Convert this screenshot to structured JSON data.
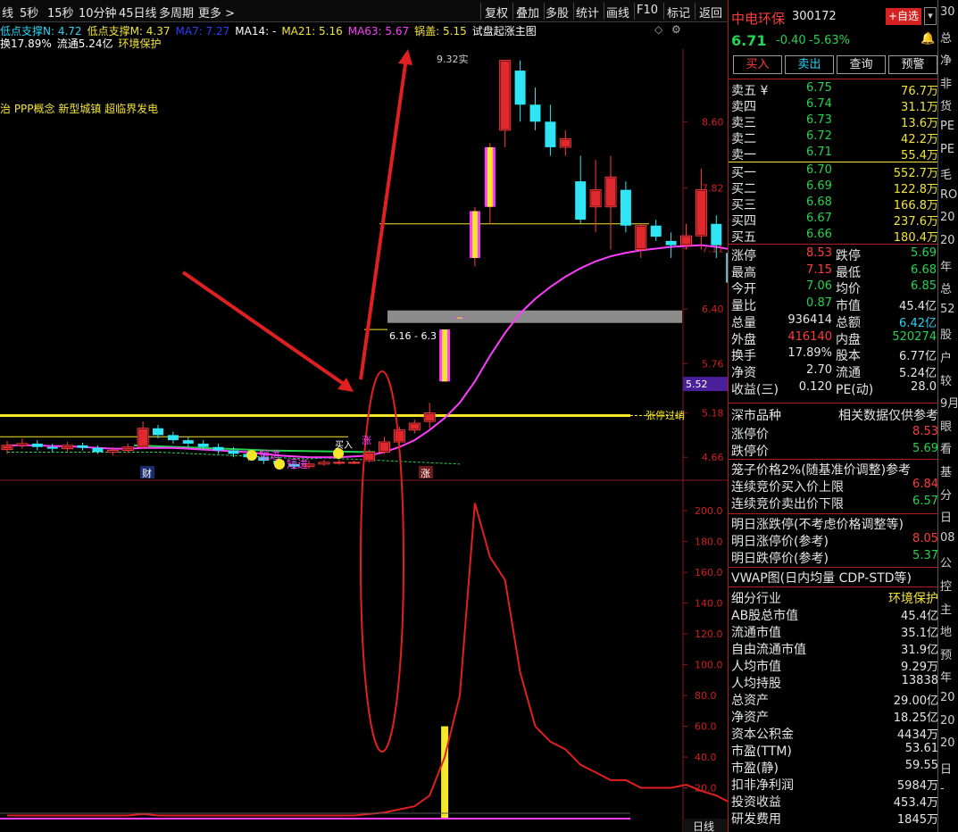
{
  "toolbar": {
    "left_items": [
      "线",
      "5秒",
      "15秒",
      "10分钟",
      "45日线",
      "多周期",
      "更多 >"
    ],
    "right_buttons": [
      "复权",
      "叠加",
      "多股",
      "统计",
      "画线",
      "F10",
      "标记",
      "返回"
    ]
  },
  "legend": {
    "line1": [
      {
        "text": "低点支撑N: 4.72",
        "color": "#2ad3f5"
      },
      {
        "text": "低点支撑M: 4.37",
        "color": "#f2e33a"
      },
      {
        "text": "MA7: 7.27",
        "color": "#2a3ef5"
      },
      {
        "text": "MA14: -",
        "color": "#ffffff"
      },
      {
        "text": "MA21: 5.16",
        "color": "#f2e33a"
      },
      {
        "text": "MA63: 5.67",
        "color": "#ff3cff"
      },
      {
        "text": "锅盖: 5.15",
        "color": "#f2e33a"
      },
      {
        "text": "试盘起涨主图",
        "color": "#ffffff"
      }
    ],
    "line2": [
      {
        "text": "换17.89%",
        "color": "#ffffff"
      },
      {
        "text": "流通5.24亿",
        "color": "#ffffff"
      },
      {
        "text": "环境保护",
        "color": "#f2e33a"
      }
    ],
    "concepts": "治 PPP概念 新型城镇 超临界发电"
  },
  "price_axis": [
    "8.60",
    "7.82",
    "7.11",
    "6.40",
    "5.76",
    "5.18",
    "4.66"
  ],
  "price_tag": "5.52",
  "volume_axis": [
    "200.0",
    "180.0",
    "160.0",
    "140.0",
    "120.0",
    "100.0",
    "80.0",
    "60.0",
    "40.0",
    "20.0"
  ],
  "annotations": {
    "high_label": "9.32实",
    "range_label": "6.16 - 6.3",
    "limit_label": "张停过峭",
    "cai": "财",
    "zhang": "涨",
    "duan1": "短进",
    "duan2": "短进",
    "buy": "买入",
    "zhang2": "涨"
  },
  "bottom_tab": "日线",
  "chart_data": {
    "type": "candlestick",
    "candles": [
      {
        "o": 4.75,
        "c": 4.8,
        "h": 4.85,
        "l": 4.7
      },
      {
        "o": 4.8,
        "c": 4.82,
        "h": 4.88,
        "l": 4.76
      },
      {
        "o": 4.82,
        "c": 4.78,
        "h": 4.86,
        "l": 4.74
      },
      {
        "o": 4.78,
        "c": 4.76,
        "h": 4.82,
        "l": 4.72
      },
      {
        "o": 4.76,
        "c": 4.8,
        "h": 4.84,
        "l": 4.73
      },
      {
        "o": 4.8,
        "c": 4.77,
        "h": 4.83,
        "l": 4.74
      },
      {
        "o": 4.77,
        "c": 4.72,
        "h": 4.8,
        "l": 4.7
      },
      {
        "o": 4.72,
        "c": 4.74,
        "h": 4.78,
        "l": 4.68
      },
      {
        "o": 4.74,
        "c": 4.78,
        "h": 4.82,
        "l": 4.71
      },
      {
        "o": 4.78,
        "c": 5.0,
        "h": 5.08,
        "l": 4.76
      },
      {
        "o": 5.0,
        "c": 4.92,
        "h": 5.04,
        "l": 4.88
      },
      {
        "o": 4.92,
        "c": 4.86,
        "h": 4.96,
        "l": 4.82
      },
      {
        "o": 4.86,
        "c": 4.82,
        "h": 4.9,
        "l": 4.78
      },
      {
        "o": 4.82,
        "c": 4.78,
        "h": 4.86,
        "l": 4.74
      },
      {
        "o": 4.78,
        "c": 4.74,
        "h": 4.82,
        "l": 4.7
      },
      {
        "o": 4.74,
        "c": 4.7,
        "h": 4.78,
        "l": 4.66
      },
      {
        "o": 4.7,
        "c": 4.66,
        "h": 4.74,
        "l": 4.62
      },
      {
        "o": 4.66,
        "c": 4.62,
        "h": 4.7,
        "l": 4.58
      },
      {
        "o": 4.62,
        "c": 4.58,
        "h": 4.66,
        "l": 4.54
      },
      {
        "o": 4.58,
        "c": 4.55,
        "h": 4.62,
        "l": 4.52
      },
      {
        "o": 4.55,
        "c": 4.58,
        "h": 4.62,
        "l": 4.52
      },
      {
        "o": 4.58,
        "c": 4.6,
        "h": 4.63,
        "l": 4.56
      },
      {
        "o": 4.6,
        "c": 4.6,
        "h": 4.63,
        "l": 4.57
      },
      {
        "o": 4.6,
        "c": 4.6,
        "h": 4.62,
        "l": 4.58
      },
      {
        "o": 4.62,
        "c": 4.72,
        "h": 4.75,
        "l": 4.6
      },
      {
        "o": 4.72,
        "c": 4.84,
        "h": 4.9,
        "l": 4.7
      },
      {
        "o": 4.84,
        "c": 4.98,
        "h": 5.02,
        "l": 4.8
      },
      {
        "o": 4.98,
        "c": 5.06,
        "h": 5.1,
        "l": 4.94
      },
      {
        "o": 5.08,
        "c": 5.18,
        "h": 5.3,
        "l": 5.0
      },
      {
        "o": 5.55,
        "c": 6.16,
        "h": 6.16,
        "l": 5.55
      },
      {
        "o": 6.3,
        "c": 6.3,
        "h": 6.3,
        "l": 6.3
      },
      {
        "o": 7.0,
        "c": 7.55,
        "h": 7.6,
        "l": 6.9
      },
      {
        "o": 7.6,
        "c": 8.3,
        "h": 8.35,
        "l": 7.4
      },
      {
        "o": 8.5,
        "c": 9.32,
        "h": 9.32,
        "l": 8.3
      },
      {
        "o": 9.2,
        "c": 8.8,
        "h": 9.32,
        "l": 8.6
      },
      {
        "o": 8.8,
        "c": 8.6,
        "h": 9.0,
        "l": 8.5
      },
      {
        "o": 8.6,
        "c": 8.3,
        "h": 8.8,
        "l": 8.2
      },
      {
        "o": 8.3,
        "c": 8.4,
        "h": 8.5,
        "l": 8.2
      },
      {
        "o": 7.9,
        "c": 7.45,
        "h": 8.2,
        "l": 7.4
      },
      {
        "o": 7.6,
        "c": 7.8,
        "h": 8.15,
        "l": 7.3
      },
      {
        "o": 7.6,
        "c": 7.95,
        "h": 8.2,
        "l": 7.1
      },
      {
        "o": 7.8,
        "c": 7.38,
        "h": 7.9,
        "l": 7.3
      },
      {
        "o": 7.1,
        "c": 7.38,
        "h": 7.4,
        "l": 7.0
      },
      {
        "o": 7.38,
        "c": 7.25,
        "h": 7.45,
        "l": 7.2
      },
      {
        "o": 7.2,
        "c": 7.15,
        "h": 7.3,
        "l": 7.0
      },
      {
        "o": 7.15,
        "c": 7.26,
        "h": 7.4,
        "l": 7.1
      },
      {
        "o": 7.26,
        "c": 7.8,
        "h": 8.05,
        "l": 7.1
      },
      {
        "o": 7.4,
        "c": 7.15,
        "h": 7.5,
        "l": 7.0
      },
      {
        "o": 7.06,
        "c": 6.71,
        "h": 7.15,
        "l": 6.68
      }
    ],
    "ma_pink": [
      4.8,
      4.8,
      4.8,
      4.79,
      4.79,
      4.78,
      4.77,
      4.76,
      4.76,
      4.77,
      4.77,
      4.77,
      4.76,
      4.75,
      4.74,
      4.73,
      4.72,
      4.7,
      4.68,
      4.67,
      4.66,
      4.66,
      4.66,
      4.67,
      4.68,
      4.72,
      4.78,
      4.86,
      4.98,
      5.12,
      5.3,
      5.55,
      5.85,
      6.12,
      6.35,
      6.52,
      6.66,
      6.78,
      6.88,
      6.96,
      7.02,
      7.06,
      7.09,
      7.11,
      7.13,
      7.14,
      7.15,
      7.13,
      7.1
    ],
    "volume": [
      2,
      2,
      2,
      2,
      2,
      2,
      2,
      2,
      2,
      3,
      2,
      2,
      2,
      2,
      2,
      2,
      2,
      2,
      2,
      2,
      2,
      2,
      2,
      2,
      3,
      4,
      6,
      8,
      15,
      40,
      80,
      205,
      170,
      155,
      95,
      60,
      50,
      45,
      35,
      30,
      25,
      25,
      20,
      20,
      20,
      22,
      18,
      15,
      10
    ],
    "volume_axis_range": [
      0,
      210
    ],
    "price_axis_range": [
      4.4,
      9.4
    ]
  },
  "quote": {
    "name": "中电环保",
    "code": "300172",
    "add_btn": "+自选",
    "price": "6.71",
    "change": "-0.40",
    "pct": "-5.63%",
    "buttons": [
      "买入",
      "卖出",
      "查询",
      "预警"
    ],
    "asks": [
      {
        "label": "卖五 ¥",
        "price": "6.75",
        "vol": "76.7万"
      },
      {
        "label": "卖四",
        "price": "6.74",
        "vol": "31.1万"
      },
      {
        "label": "卖三",
        "price": "6.73",
        "vol": "13.6万"
      },
      {
        "label": "卖二",
        "price": "6.72",
        "vol": "42.2万"
      },
      {
        "label": "卖一",
        "price": "6.71",
        "vol": "55.4万"
      }
    ],
    "bids": [
      {
        "label": "买一",
        "price": "6.70",
        "vol": "552.7万"
      },
      {
        "label": "买二",
        "price": "6.69",
        "vol": "122.8万"
      },
      {
        "label": "买三",
        "price": "6.68",
        "vol": "166.8万"
      },
      {
        "label": "买四",
        "price": "6.67",
        "vol": "237.6万"
      },
      {
        "label": "买五",
        "price": "6.66",
        "vol": "180.4万"
      }
    ],
    "stats": [
      {
        "k1": "涨停",
        "v1": "8.53",
        "c1": "red",
        "k2": "跌停",
        "v2": "5.69",
        "c2": "green"
      },
      {
        "k1": "最高",
        "v1": "7.15",
        "c1": "red",
        "k2": "最低",
        "v2": "6.68",
        "c2": "green"
      },
      {
        "k1": "今开",
        "v1": "7.06",
        "c1": "green",
        "k2": "均价",
        "v2": "6.85",
        "c2": "green"
      },
      {
        "k1": "量比",
        "v1": "0.87",
        "c1": "green",
        "k2": "市值",
        "v2": "45.4亿",
        "c2": "white"
      },
      {
        "k1": "总量",
        "v1": "936414",
        "c1": "white",
        "k2": "总额",
        "v2": "6.42亿",
        "c2": "cyan"
      },
      {
        "k1": "外盘",
        "v1": "416140",
        "c1": "red",
        "k2": "内盘",
        "v2": "520274",
        "c2": "green"
      },
      {
        "k1": "换手",
        "v1": "17.89%",
        "c1": "white",
        "k2": "股本",
        "v2": "6.77亿",
        "c2": "white"
      },
      {
        "k1": "净资",
        "v1": "2.70",
        "c1": "white",
        "k2": "流通",
        "v2": "5.24亿",
        "c2": "white"
      },
      {
        "k1": "收益(三)",
        "v1": "0.120",
        "c1": "white",
        "k2": "PE(动)",
        "v2": "28.0",
        "c2": "white"
      }
    ],
    "market": {
      "left": "深市品种",
      "right": "相关数据仅供参考"
    },
    "limits": [
      {
        "k": "涨停价",
        "v": "8.53",
        "c": "red"
      },
      {
        "k": "跌停价",
        "v": "5.69",
        "c": "green"
      }
    ],
    "cage": [
      {
        "k": "笼子价格2%(随基准价调整)参考",
        "v": "",
        "c": "white"
      },
      {
        "k": "连续竞价买入价上限",
        "v": "6.84",
        "c": "red"
      },
      {
        "k": "连续竞价卖出价下限",
        "v": "6.57",
        "c": "green"
      }
    ],
    "tomorrow": [
      {
        "k": "明日涨跌停(不考虑价格调整等)",
        "v": "",
        "c": "white"
      },
      {
        "k": "明日涨停价(参考)",
        "v": "8.05",
        "c": "red"
      },
      {
        "k": "明日跌停价(参考)",
        "v": "5.37",
        "c": "green"
      }
    ],
    "vwap": "VWAP图(日内均量 CDP-STD等)",
    "industry": {
      "k": "细分行业",
      "v": "环境保护"
    },
    "fundamentals": [
      {
        "k": "AB股总市值",
        "v": "45.4亿"
      },
      {
        "k": "流通市值",
        "v": "35.1亿"
      },
      {
        "k": "自由流通市值",
        "v": "31.9亿"
      },
      {
        "k": "人均市值",
        "v": "9.29万"
      },
      {
        "k": "人均持股",
        "v": "13838"
      },
      {
        "k": "总资产",
        "v": "29.00亿"
      },
      {
        "k": "净资产",
        "v": "18.25亿"
      },
      {
        "k": "资本公积金",
        "v": "4434万"
      },
      {
        "k": "市盈(TTM)",
        "v": "53.61"
      },
      {
        "k": "市盈(静)",
        "v": "59.55"
      },
      {
        "k": "扣非净利润",
        "v": "5984万"
      },
      {
        "k": "投资收益",
        "v": "453.4万"
      },
      {
        "k": "研发费用",
        "v": "1845万"
      }
    ]
  },
  "edge": [
    "30",
    "总",
    "净",
    "非",
    "货",
    "PE",
    "PE",
    "毛",
    "RO",
    "20",
    "20",
    "年",
    "总",
    "52",
    "股",
    "户",
    "较",
    "9月",
    "眼",
    "看",
    "基",
    "分",
    "日",
    "08",
    "公",
    "控",
    "主",
    "地",
    "预",
    "年",
    "20",
    "20",
    "20",
    "日",
    "-"
  ]
}
